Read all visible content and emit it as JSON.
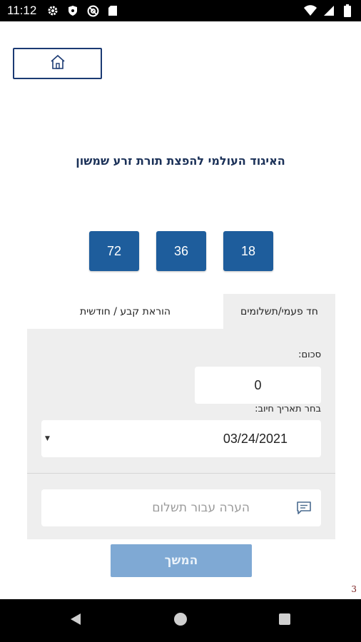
{
  "status_bar": {
    "time": "11:12",
    "icons_left": [
      "gear-icon",
      "shield-icon",
      "at-sign-icon",
      "sd-card-icon"
    ],
    "icons_right": [
      "wifi-icon",
      "cellular-icon",
      "battery-icon"
    ]
  },
  "header": {
    "home_icon": "home-icon"
  },
  "org_title": "האיגוד העולמי להפצת תורת זרע שמשון",
  "amount_options": [
    "72",
    "36",
    "18"
  ],
  "tabs": {
    "active": "חד פעמי/תשלומים",
    "inactive": "הוראת קבע / חודשית"
  },
  "form": {
    "sum_label": "סכום:",
    "sum_value": "0",
    "date_label": "בחר תאריך חיוב:",
    "date_value": "03/24/2021",
    "note_placeholder": "הערה עבור תשלום"
  },
  "continue_label": "המשך",
  "page_number": "3",
  "colors": {
    "primary": "#1e5d9c",
    "title": "#1b3158",
    "panel": "#eeeeee",
    "continue_disabled": "#7fa9d4"
  }
}
